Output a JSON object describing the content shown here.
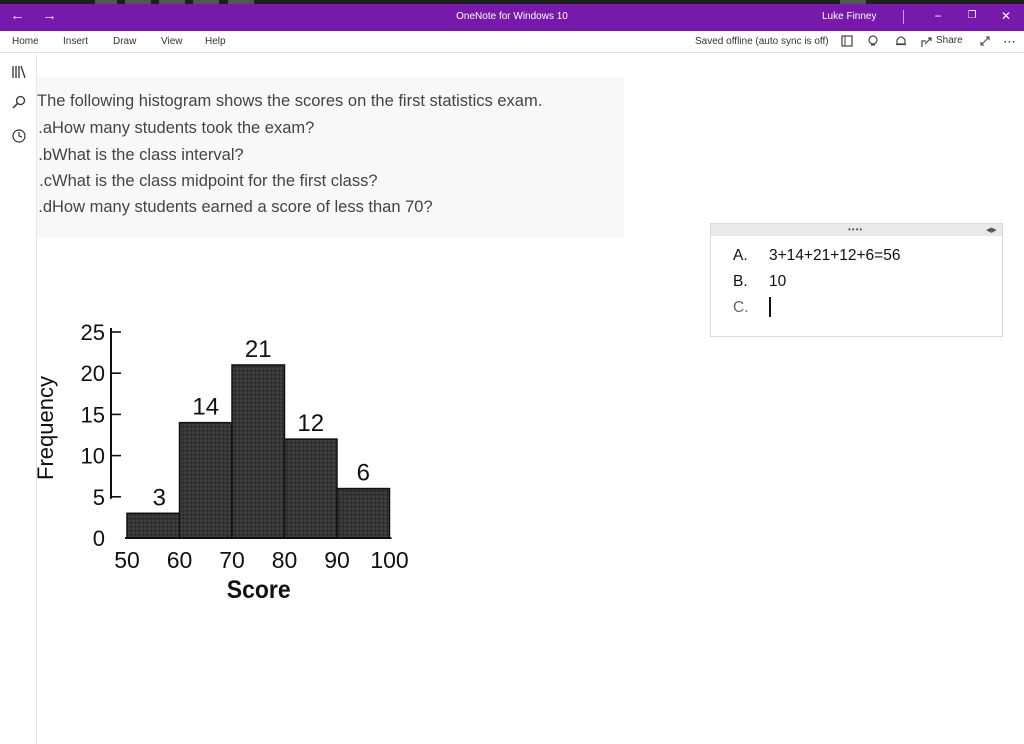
{
  "window": {
    "title": "OneNote for Windows 10",
    "user": "Luke Finney",
    "back_icon": "←",
    "forward_icon": "→",
    "minimize_icon": "−",
    "restore_icon": "❐",
    "close_icon": "✕"
  },
  "ribbon": {
    "tabs": [
      "Home",
      "Insert",
      "Draw",
      "View",
      "Help"
    ],
    "status": "Saved offline (auto sync is off)",
    "share_label": "Share",
    "more_icon": "⋯"
  },
  "question": {
    "title": "The following histogram shows the scores on the first statistics exam.",
    "items": [
      {
        "prefix": "a.",
        "text": "How many students took the exam?"
      },
      {
        "prefix": "b.",
        "text": "What is the class interval?"
      },
      {
        "prefix": "c.",
        "text": "What is the class midpoint for the first class?"
      },
      {
        "prefix": "d.",
        "text": "How many students earned a score of less than 70?"
      }
    ]
  },
  "answers": [
    {
      "label": "A.",
      "text": "3+14+21+12+6=56"
    },
    {
      "label": "B.",
      "text": "10"
    },
    {
      "label": "C.",
      "text": ""
    }
  ],
  "chart_data": {
    "type": "bar",
    "categories": [
      "50-60",
      "60-70",
      "70-80",
      "80-90",
      "90-100"
    ],
    "values": [
      3,
      14,
      21,
      12,
      6
    ],
    "data_labels": [
      "3",
      "14",
      "21",
      "12",
      "6"
    ],
    "x_ticks": [
      "50",
      "60",
      "70",
      "80",
      "90",
      "100"
    ],
    "y_ticks": [
      "0",
      "5",
      "10",
      "15",
      "20",
      "25"
    ],
    "xlabel": "Score",
    "ylabel": "Frequency",
    "ylim": [
      0,
      25
    ],
    "bar_color": "#2a2a2a"
  },
  "colors": {
    "titlebar": "#7719aa"
  }
}
